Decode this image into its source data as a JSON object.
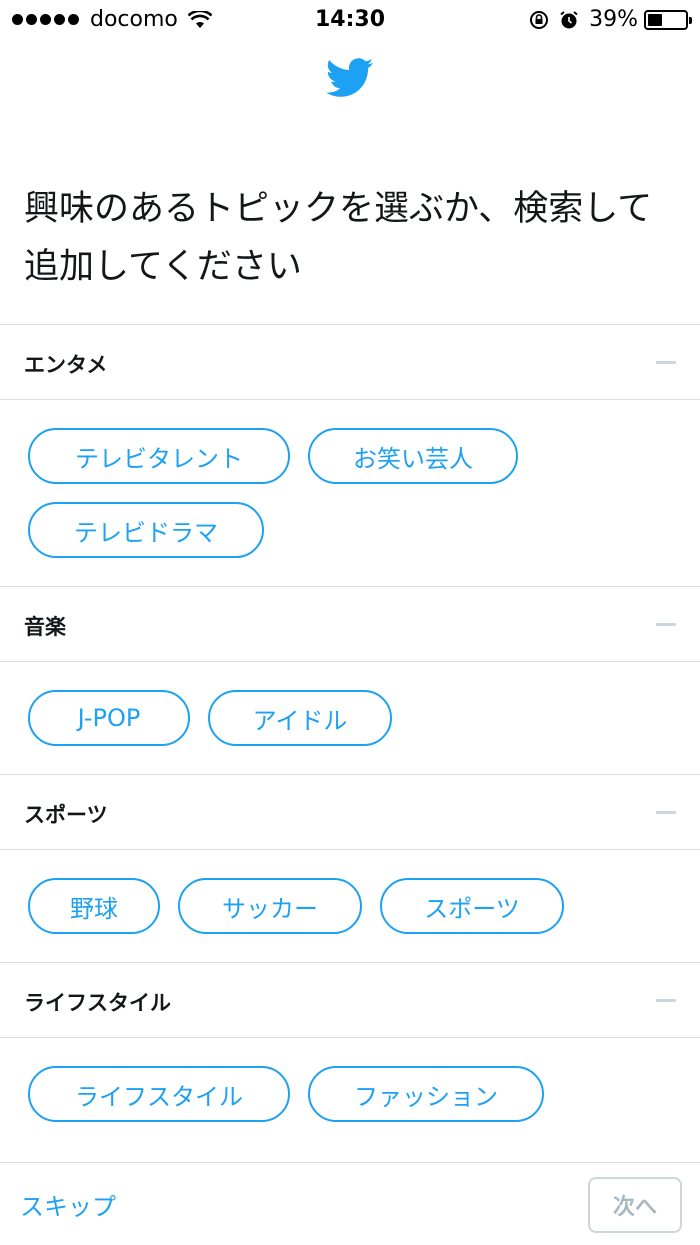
{
  "status_bar": {
    "carrier": "docomo",
    "time": "14:30",
    "battery": "39%",
    "battery_level": 0.39
  },
  "logo_icon": "twitter-bird-icon",
  "heading": "興味のあるトピックを選ぶか、検索して追加してください",
  "sections": [
    {
      "title": "エンタメ",
      "chip_rows": [
        [
          {
            "label": "テレビタレント"
          },
          {
            "label": "お笑い芸人"
          }
        ],
        [
          {
            "label": "テレビドラマ"
          }
        ]
      ]
    },
    {
      "title": "音楽",
      "chip_rows": [
        [
          {
            "label": "J-POP"
          },
          {
            "label": "アイドル"
          }
        ]
      ]
    },
    {
      "title": "スポーツ",
      "chip_rows": [
        [
          {
            "label": "野球"
          },
          {
            "label": "サッカー"
          },
          {
            "label": "スポーツ"
          }
        ]
      ]
    },
    {
      "title": "ライフスタイル",
      "chip_rows": [
        [
          {
            "label": "ライフスタイル"
          },
          {
            "label": "ファッション"
          }
        ]
      ]
    }
  ],
  "footer": {
    "skip_label": "スキップ",
    "next_label": "次へ"
  },
  "colors": {
    "accent": "#1da1f2",
    "divider": "#d8dde2",
    "disabled": "#aab8c2"
  }
}
